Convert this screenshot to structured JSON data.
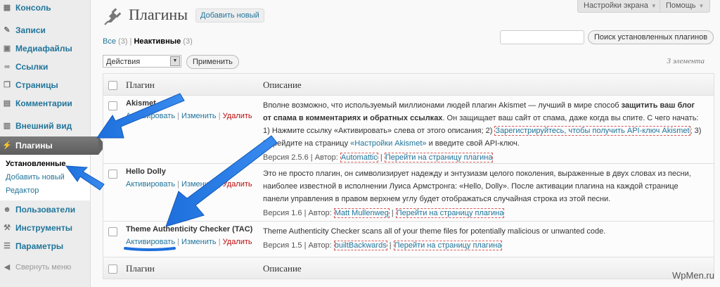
{
  "sidebar": {
    "items": [
      {
        "label": "Консоль",
        "icon": "dashboard-icon"
      },
      {
        "label": "Записи",
        "icon": "pin-icon"
      },
      {
        "label": "Медиафайлы",
        "icon": "media-icon"
      },
      {
        "label": "Ссылки",
        "icon": "links-icon"
      },
      {
        "label": "Страницы",
        "icon": "pages-icon"
      },
      {
        "label": "Комментарии",
        "icon": "comments-icon"
      },
      {
        "label": "Внешний вид",
        "icon": "appearance-icon"
      },
      {
        "label": "Плагины",
        "icon": "plugins-icon"
      }
    ],
    "submenu": [
      "Установленные",
      "Добавить новый",
      "Редактор"
    ],
    "items2": [
      {
        "label": "Пользователи",
        "icon": "users-icon"
      },
      {
        "label": "Инструменты",
        "icon": "tools-icon"
      },
      {
        "label": "Параметры",
        "icon": "settings-icon"
      }
    ],
    "collapse": "Свернуть меню"
  },
  "header": {
    "screen_options": "Настройки экрана",
    "help": "Помощь",
    "title": "Плагины",
    "add_new": "Добавить новый"
  },
  "filters": {
    "all": "Все",
    "all_count": "(3)",
    "inactive": "Неактивные",
    "inactive_count": "(3)"
  },
  "search": {
    "button": "Поиск установленных плагинов",
    "value": ""
  },
  "bulk": {
    "selected": "Действия",
    "apply": "Применить",
    "items_count": "3 элемента"
  },
  "table": {
    "col_plugin": "Плагин",
    "col_desc": "Описание",
    "plugins": [
      {
        "name": "Akismet",
        "activate": "Активировать",
        "edit": "Изменить",
        "delete": "Удалить",
        "desc_a": "Вполне возможно, что используемый миллионами людей плагин Akismet — лучший в мире способ ",
        "desc_b": "защитить ваш блог от спама в комментариях и обратных ссылках",
        "desc_c": ". Он защищает ваш сайт от спама, даже когда вы спите. С чего начать: 1) Нажмите ссылку «Активировать» слева от этого описания; 2) ",
        "desc_link": "Зарегистрируйтесь, чтобы получить API-ключ Akismet",
        "desc_d": "; 3) Перейдите на страницу ",
        "desc_link2": "«Настройки Akismet»",
        "desc_e": " и введите свой API-ключ.",
        "version": "Версия 2.5.6",
        "author_label": "Автор:",
        "author": "Automattic",
        "site": "Перейти на страницу плагина"
      },
      {
        "name": "Hello Dolly",
        "activate": "Активировать",
        "edit": "Изменить",
        "delete": "Удалить",
        "desc_a": "Это не просто плагин, он символизирует надежду и энтузиазм целого поколения, выраженные в двух словах из песни, наиболее известной в исполнении Луиса Армстронга: «Hello, Dolly». После активации плагина на каждой странице панели управления в правом верхнем углу будет отображаться случайная строка из этой песни.",
        "version": "Версия 1.6",
        "author_label": "Автор:",
        "author": "Matt Mullenweg",
        "site": "Перейти на страницу плагина"
      },
      {
        "name": "Theme Authenticity Checker (TAC)",
        "activate": "Активировать",
        "edit": "Изменить",
        "delete": "Удалить",
        "desc_a": "Theme Authenticity Checker scans all of your theme files for potentially malicious or unwanted code.",
        "version": "Версия 1.5",
        "author_label": "Автор:",
        "author": "builtBackwards",
        "site": "Перейти на страницу плагина"
      }
    ]
  },
  "watermark": "WpMen.ru",
  "colors": {
    "link": "#21759b",
    "delete": "#bc0b0b",
    "arrow": "#1d6fdc"
  }
}
